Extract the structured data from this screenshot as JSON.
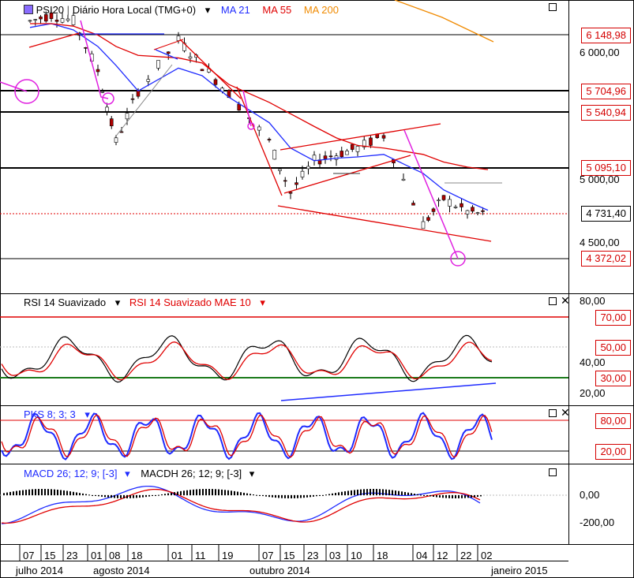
{
  "panels": {
    "price": {
      "symbol": "PSI20",
      "interval": "Diário Hora Local (TMG+0)",
      "ma21": "MA 21",
      "ma55": "MA 55",
      "ma200": "MA 200",
      "levels": [
        "6 148,98",
        "5 704,96",
        "5 540,94",
        "5 095,10",
        "4 731,40",
        "4 372,02"
      ],
      "ticks": [
        "6 000,00",
        "5 000,00",
        "4 500,00"
      ]
    },
    "rsi": {
      "title": "RSI 14 Suavizado",
      "sub": "RSI 14 Suavizado MAE 10",
      "levels": [
        "70,00",
        "50,00",
        "30,00"
      ],
      "ticks": [
        "80,00",
        "40,00",
        "20,00"
      ]
    },
    "pks": {
      "title": "PKS 8; 3; 3",
      "levels": [
        "80,00",
        "20,00"
      ]
    },
    "macd": {
      "title1": "MACD 26; 12; 9; [-3]",
      "title2": "MACDH 26; 12; 9; [-3]",
      "ticks": [
        "0,00",
        "-200,00"
      ]
    }
  },
  "dates": [
    "07",
    "15",
    "23",
    "01",
    "08",
    "18",
    "01",
    "11",
    "19",
    "07",
    "15",
    "23",
    "03",
    "10",
    "18",
    "04",
    "12",
    "22",
    "02"
  ],
  "months": [
    "julho 2014",
    "agosto 2014",
    "outubro 2014",
    "janeiro 2015"
  ],
  "colors": {
    "ma21": "#1f2bff",
    "ma55": "#e00000",
    "ma200": "#f08a00",
    "level": "#d40000",
    "support": "#1a7a1a"
  },
  "chart_data": {
    "type": "line",
    "title": "PSI20",
    "x": [
      "07 jul",
      "15 jul",
      "23 jul",
      "01 ago",
      "08 ago",
      "18 ago",
      "01 set",
      "11 set",
      "19 set",
      "07 out",
      "15 out",
      "23 out",
      "03 nov",
      "10 nov",
      "18 nov",
      "04 dez",
      "12 dez",
      "22 dez",
      "02 jan"
    ],
    "series": [
      {
        "name": "PSI20",
        "values": [
          6250,
          6300,
          6250,
          5860,
          5300,
          5700,
          6100,
          5900,
          5680,
          5300,
          4900,
          5150,
          5200,
          5250,
          5350,
          4650,
          4850,
          4750,
          4720
        ]
      },
      {
        "name": "MA 21",
        "values": [
          6200,
          6230,
          6180,
          6050,
          5900,
          5700,
          5880,
          5820,
          5650,
          5450,
          5250,
          5150,
          5170,
          5180,
          5200,
          5050,
          4920,
          4830,
          4760
        ]
      },
      {
        "name": "MA 55",
        "values": [
          6230,
          6230,
          6210,
          6140,
          6050,
          5980,
          5960,
          5920,
          5750,
          5610,
          5520,
          5420,
          5330,
          5270,
          5250,
          5200,
          5140,
          5100,
          5080
        ]
      },
      {
        "name": "MA 200",
        "values": [
          null,
          null,
          null,
          null,
          null,
          null,
          null,
          null,
          null,
          null,
          null,
          null,
          null,
          null,
          null,
          null,
          6330,
          6240,
          6160
        ]
      }
    ],
    "levels": [
      6148.98,
      5704.96,
      5540.94,
      5095.1,
      4731.4,
      4372.02
    ],
    "yticks": [
      6000,
      5000,
      4500
    ]
  }
}
